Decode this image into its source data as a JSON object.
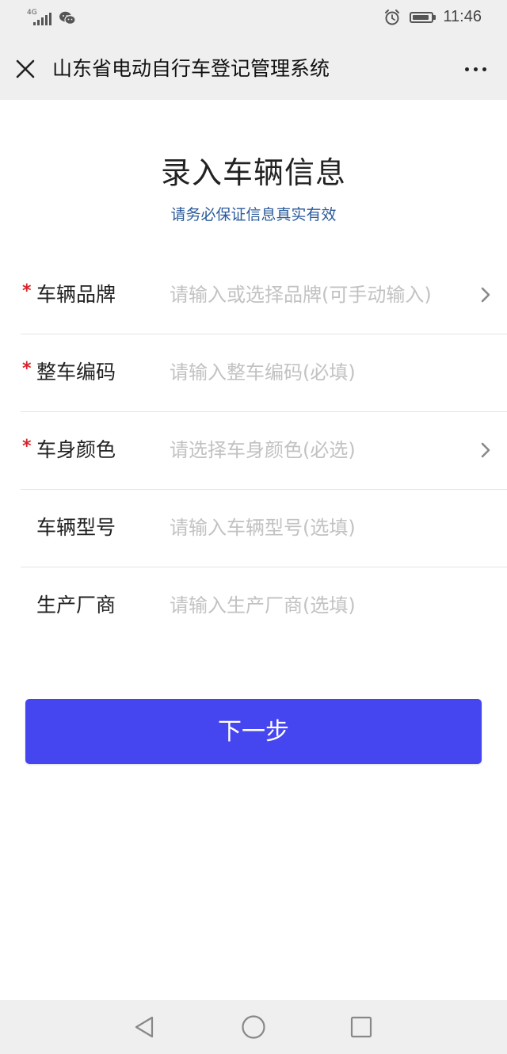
{
  "status_bar": {
    "network": "4G",
    "signal_icon": "signal-icon",
    "wechat_icon": "wechat-icon",
    "alarm_icon": "alarm-icon",
    "battery_icon": "battery-icon",
    "time": "11:46"
  },
  "title_bar": {
    "close_icon": "close-icon",
    "title": "山东省电动自行车登记管理系统",
    "more_icon": "more-icon"
  },
  "page": {
    "heading": "录入车辆信息",
    "subtitle": "请务必保证信息真实有效"
  },
  "form": {
    "fields": [
      {
        "label": "车辆品牌",
        "placeholder": "请输入或选择品牌(可手动输入)",
        "required": true,
        "has_chevron": true
      },
      {
        "label": "整车编码",
        "placeholder": "请输入整车编码(必填)",
        "required": true,
        "has_chevron": false
      },
      {
        "label": "车身颜色",
        "placeholder": "请选择车身颜色(必选)",
        "required": true,
        "has_chevron": true
      },
      {
        "label": "车辆型号",
        "placeholder": "请输入车辆型号(选填)",
        "required": false,
        "has_chevron": false
      },
      {
        "label": "生产厂商",
        "placeholder": "请输入生产厂商(选填)",
        "required": false,
        "has_chevron": false
      }
    ],
    "required_mark": "*"
  },
  "next_button": {
    "label": "下一步",
    "color": "#4646f0"
  },
  "nav_bar": {
    "back_icon": "back-triangle-icon",
    "home_icon": "home-circle-icon",
    "recents_icon": "recents-square-icon"
  },
  "colors": {
    "required": "#d8232a",
    "subtitle": "#2a5a9a",
    "placeholder": "#c2c2c2",
    "bar_background": "#efefef"
  }
}
